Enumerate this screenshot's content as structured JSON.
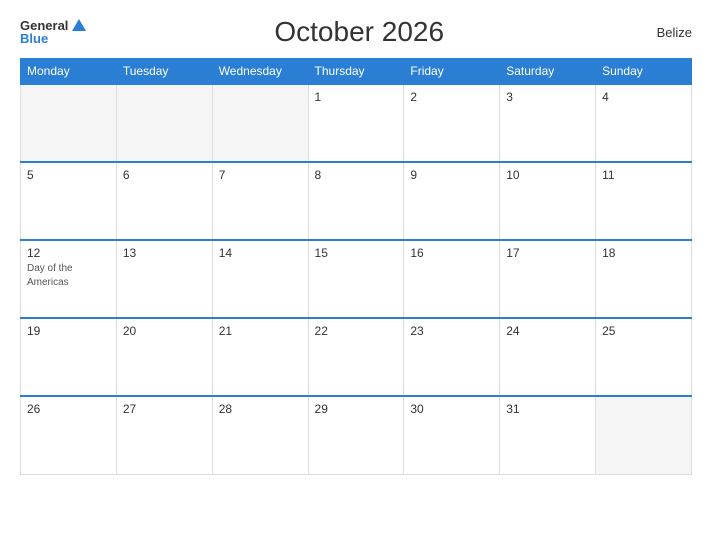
{
  "header": {
    "logo_general": "General",
    "logo_blue": "Blue",
    "title": "October 2026",
    "country": "Belize"
  },
  "weekdays": [
    "Monday",
    "Tuesday",
    "Wednesday",
    "Thursday",
    "Friday",
    "Saturday",
    "Sunday"
  ],
  "weeks": [
    [
      {
        "num": "",
        "empty": true
      },
      {
        "num": "",
        "empty": true
      },
      {
        "num": "",
        "empty": true
      },
      {
        "num": "1",
        "empty": false
      },
      {
        "num": "2",
        "empty": false
      },
      {
        "num": "3",
        "empty": false
      },
      {
        "num": "4",
        "empty": false
      }
    ],
    [
      {
        "num": "5",
        "empty": false
      },
      {
        "num": "6",
        "empty": false
      },
      {
        "num": "7",
        "empty": false
      },
      {
        "num": "8",
        "empty": false
      },
      {
        "num": "9",
        "empty": false
      },
      {
        "num": "10",
        "empty": false
      },
      {
        "num": "11",
        "empty": false
      }
    ],
    [
      {
        "num": "12",
        "empty": false,
        "event": "Day of the Americas"
      },
      {
        "num": "13",
        "empty": false
      },
      {
        "num": "14",
        "empty": false
      },
      {
        "num": "15",
        "empty": false
      },
      {
        "num": "16",
        "empty": false
      },
      {
        "num": "17",
        "empty": false
      },
      {
        "num": "18",
        "empty": false
      }
    ],
    [
      {
        "num": "19",
        "empty": false
      },
      {
        "num": "20",
        "empty": false
      },
      {
        "num": "21",
        "empty": false
      },
      {
        "num": "22",
        "empty": false
      },
      {
        "num": "23",
        "empty": false
      },
      {
        "num": "24",
        "empty": false
      },
      {
        "num": "25",
        "empty": false
      }
    ],
    [
      {
        "num": "26",
        "empty": false
      },
      {
        "num": "27",
        "empty": false
      },
      {
        "num": "28",
        "empty": false
      },
      {
        "num": "29",
        "empty": false
      },
      {
        "num": "30",
        "empty": false
      },
      {
        "num": "31",
        "empty": false
      },
      {
        "num": "",
        "empty": true
      }
    ]
  ]
}
